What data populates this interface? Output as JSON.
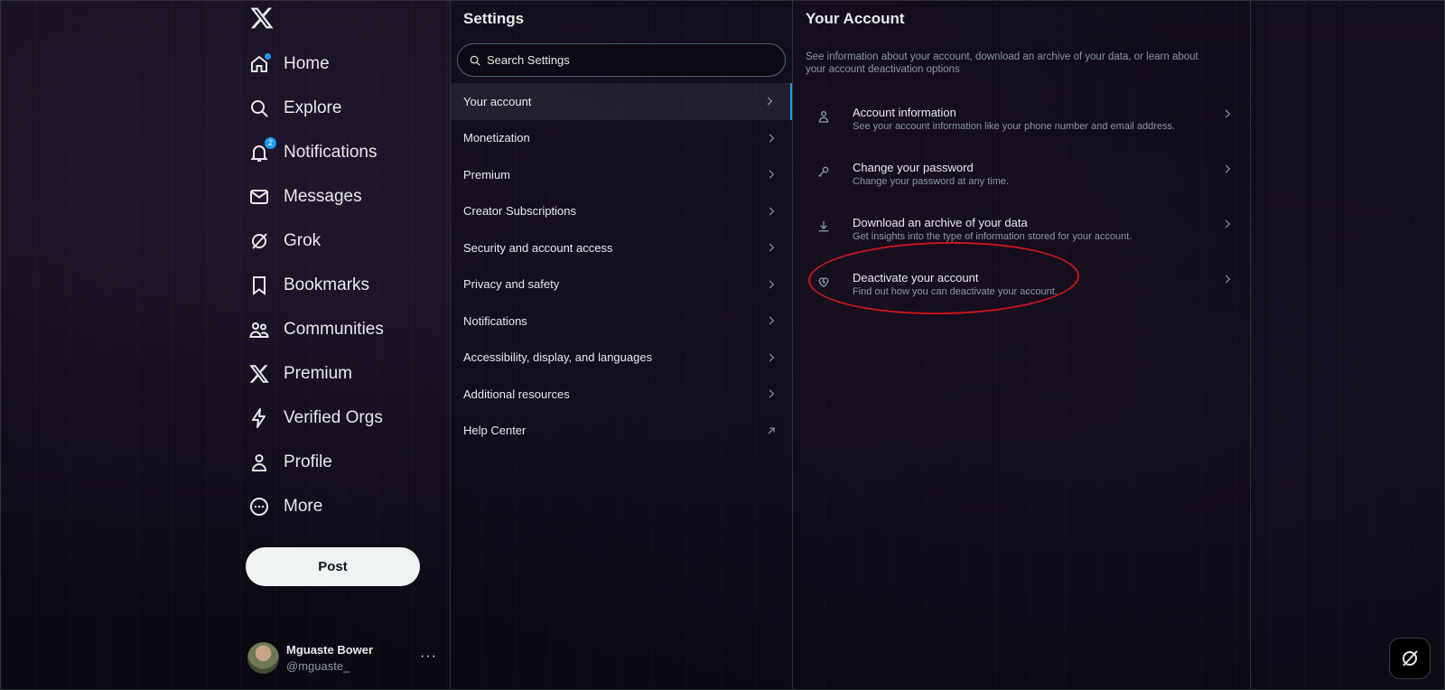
{
  "nav": {
    "logo_icon": "x-logo-icon",
    "items": [
      {
        "label": "Home",
        "icon": "home-icon",
        "has_dot": true
      },
      {
        "label": "Explore",
        "icon": "search-icon"
      },
      {
        "label": "Notifications",
        "icon": "bell-icon",
        "badge": "2"
      },
      {
        "label": "Messages",
        "icon": "envelope-icon"
      },
      {
        "label": "Grok",
        "icon": "grok-icon"
      },
      {
        "label": "Bookmarks",
        "icon": "bookmark-icon"
      },
      {
        "label": "Communities",
        "icon": "communities-icon"
      },
      {
        "label": "Premium",
        "icon": "x-logo-icon"
      },
      {
        "label": "Verified Orgs",
        "icon": "lightning-icon"
      },
      {
        "label": "Profile",
        "icon": "person-icon"
      },
      {
        "label": "More",
        "icon": "more-circle-icon"
      }
    ],
    "post_label": "Post",
    "user": {
      "name": "Mguaste Bower",
      "handle": "@mguaste_",
      "more": "···"
    }
  },
  "settings": {
    "title": "Settings",
    "search_placeholder": "Search Settings",
    "items": [
      {
        "label": "Your account",
        "active": true,
        "icon": "chevron-right-icon"
      },
      {
        "label": "Monetization",
        "icon": "chevron-right-icon"
      },
      {
        "label": "Premium",
        "icon": "chevron-right-icon"
      },
      {
        "label": "Creator Subscriptions",
        "icon": "chevron-right-icon"
      },
      {
        "label": "Security and account access",
        "icon": "chevron-right-icon"
      },
      {
        "label": "Privacy and safety",
        "icon": "chevron-right-icon"
      },
      {
        "label": "Notifications",
        "icon": "chevron-right-icon"
      },
      {
        "label": "Accessibility, display, and languages",
        "icon": "chevron-right-icon"
      },
      {
        "label": "Additional resources",
        "icon": "chevron-right-icon"
      },
      {
        "label": "Help Center",
        "icon": "external-link-icon"
      }
    ]
  },
  "your_account": {
    "title": "Your Account",
    "description": "See information about your account, download an archive of your data, or learn about your account deactivation options",
    "options": [
      {
        "title": "Account information",
        "subtitle": "See your account information like your phone number and email address.",
        "icon": "person-icon"
      },
      {
        "title": "Change your password",
        "subtitle": "Change your password at any time.",
        "icon": "key-icon"
      },
      {
        "title": "Download an archive of your data",
        "subtitle": "Get insights into the type of information stored for your account.",
        "icon": "download-icon"
      },
      {
        "title": "Deactivate your account",
        "subtitle": "Find out how you can deactivate your account.",
        "icon": "broken-heart-icon"
      }
    ]
  },
  "colors": {
    "accent": "#1d9bf0",
    "annotation": "#c8161d"
  }
}
